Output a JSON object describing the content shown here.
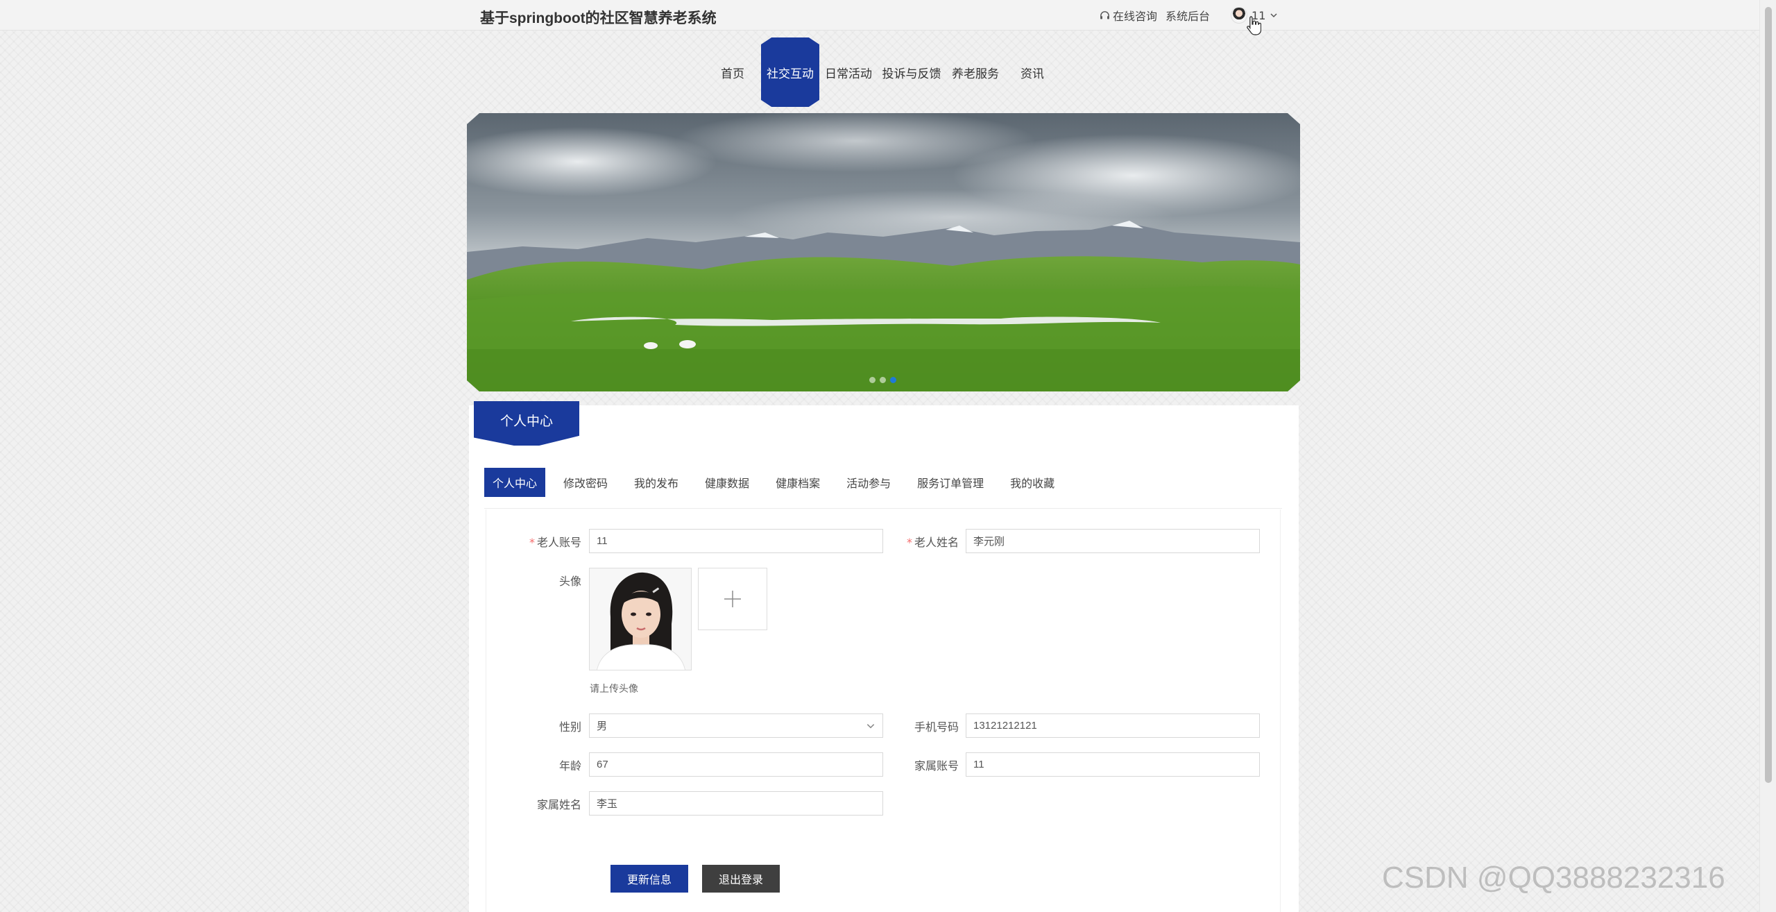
{
  "site": {
    "title": "基于springboot的社区智慧养老系统"
  },
  "header": {
    "consult_label": "在线咨询",
    "backend_label": "系统后台",
    "username": "11"
  },
  "nav": {
    "items": [
      {
        "label": "首页",
        "active": false
      },
      {
        "label": "社交互动",
        "active": true
      },
      {
        "label": "日常活动",
        "active": false
      },
      {
        "label": "投诉与反馈",
        "active": false
      },
      {
        "label": "养老服务",
        "active": false
      },
      {
        "label": "资讯",
        "active": false
      }
    ]
  },
  "banner": {
    "slide_count": 3,
    "active_slide": 3
  },
  "panel": {
    "title": "个人中心"
  },
  "tabs": [
    {
      "label": "个人中心",
      "active": true
    },
    {
      "label": "修改密码",
      "active": false
    },
    {
      "label": "我的发布",
      "active": false
    },
    {
      "label": "健康数据",
      "active": false
    },
    {
      "label": "健康档案",
      "active": false
    },
    {
      "label": "活动参与",
      "active": false
    },
    {
      "label": "服务订单管理",
      "active": false
    },
    {
      "label": "我的收藏",
      "active": false
    }
  ],
  "form": {
    "account_label": "老人账号",
    "account_value": "11",
    "name_label": "老人姓名",
    "name_value": "李元刚",
    "avatar_label": "头像",
    "avatar_tip": "请上传头像",
    "gender_label": "性别",
    "gender_value": "男",
    "phone_label": "手机号码",
    "phone_value": "13121212121",
    "age_label": "年龄",
    "age_value": "67",
    "family_account_label": "家属账号",
    "family_account_value": "11",
    "family_name_label": "家属姓名",
    "family_name_value": "李玉"
  },
  "buttons": {
    "update": "更新信息",
    "logout": "退出登录"
  },
  "watermark": "CSDN @QQ3888232316",
  "colors": {
    "primary": "#1a3a9c",
    "dark_button": "#3f3f3f",
    "required": "#f56c6c"
  }
}
